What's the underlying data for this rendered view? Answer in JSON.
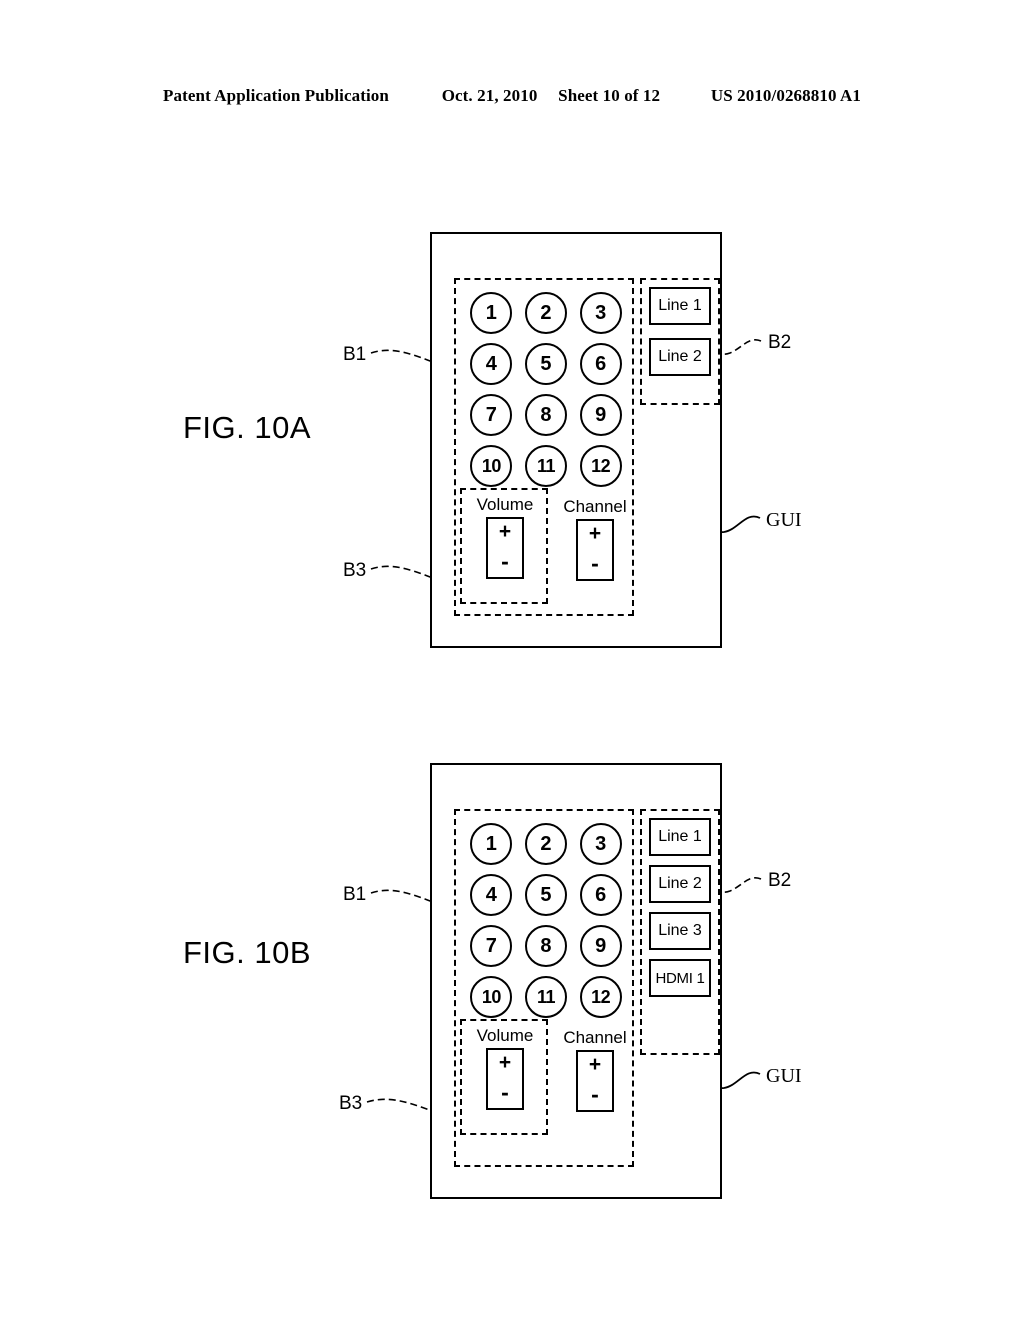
{
  "header": {
    "publication": "Patent Application Publication",
    "date": "Oct. 21, 2010",
    "sheet": "Sheet 10 of 12",
    "patent_number": "US 2010/0268810 A1"
  },
  "figures": [
    {
      "caption": "FIG. 10A",
      "keypad": {
        "rows": [
          [
            "1",
            "2",
            "3"
          ],
          [
            "4",
            "5",
            "6"
          ],
          [
            "7",
            "8",
            "9"
          ],
          [
            "10",
            "11",
            "12"
          ]
        ]
      },
      "controls": {
        "volume": {
          "label": "Volume",
          "plus": "+",
          "minus": "-"
        },
        "channel": {
          "label": "Channel",
          "plus": "+",
          "minus": "-"
        }
      },
      "source_buttons": [
        "Line 1",
        "Line 2"
      ],
      "refs": {
        "b1": "B1",
        "b2": "B2",
        "b3": "B3",
        "gui": "GUI"
      }
    },
    {
      "caption": "FIG. 10B",
      "keypad": {
        "rows": [
          [
            "1",
            "2",
            "3"
          ],
          [
            "4",
            "5",
            "6"
          ],
          [
            "7",
            "8",
            "9"
          ],
          [
            "10",
            "11",
            "12"
          ]
        ]
      },
      "controls": {
        "volume": {
          "label": "Volume",
          "plus": "+",
          "minus": "-"
        },
        "channel": {
          "label": "Channel",
          "plus": "+",
          "minus": "-"
        }
      },
      "source_buttons": [
        "Line 1",
        "Line 2",
        "Line 3",
        "HDMI 1"
      ],
      "refs": {
        "b1": "B1",
        "b2": "B2",
        "b3": "B3",
        "gui": "GUI"
      }
    }
  ],
  "colors": {
    "ink": "#000000",
    "paper": "#ffffff"
  }
}
